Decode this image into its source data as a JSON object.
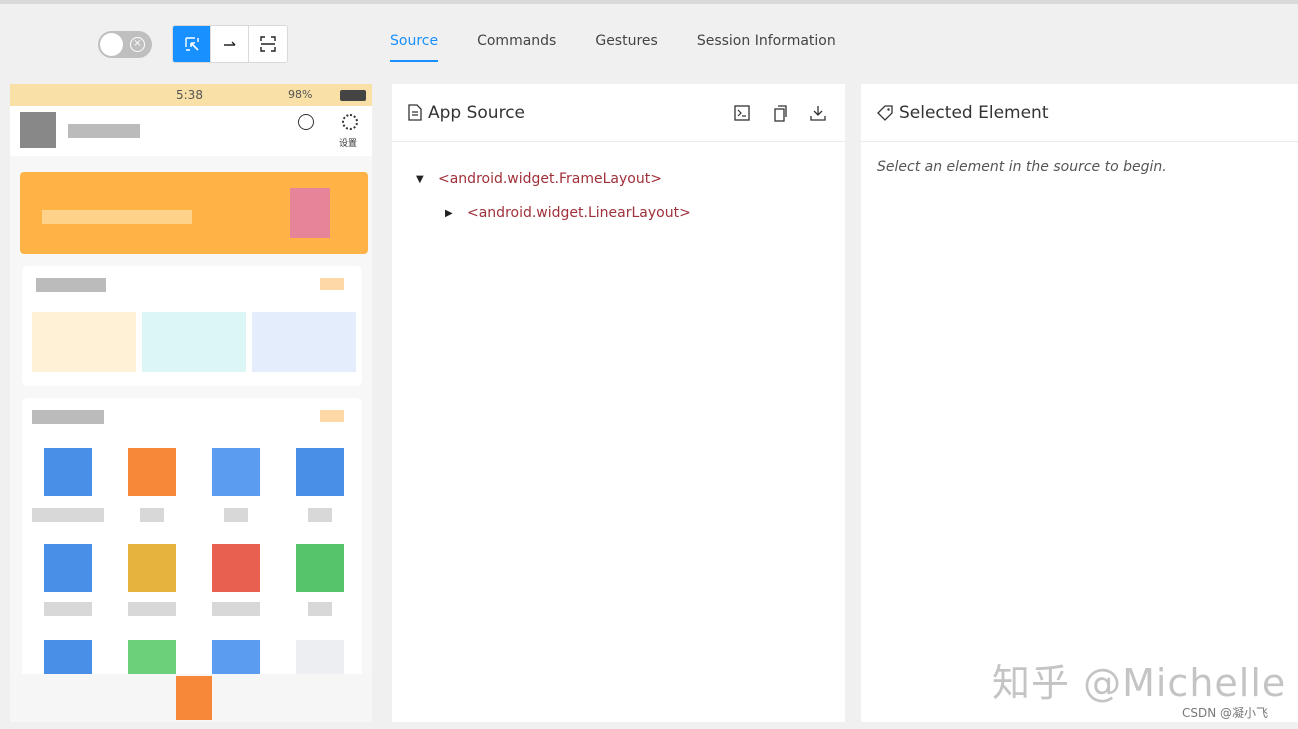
{
  "toolbar": {
    "tabs": [
      {
        "label": "Source",
        "active": true
      },
      {
        "label": "Commands",
        "active": false
      },
      {
        "label": "Gestures",
        "active": false
      },
      {
        "label": "Session Information",
        "active": false
      }
    ],
    "tools": [
      "select-elements-icon",
      "swipe-arrow-icon",
      "tap-by-coordinates-icon"
    ]
  },
  "device": {
    "status_time": "5:38",
    "status_right": "98%",
    "header_labels": [
      "设置"
    ]
  },
  "app_source": {
    "title": "App Source",
    "icons": [
      "terminal-icon",
      "copy-icon",
      "download-icon"
    ],
    "tree": [
      {
        "label": "<android.widget.FrameLayout>",
        "expanded": true
      },
      {
        "label": "<android.widget.LinearLayout>",
        "expanded": false
      }
    ]
  },
  "selected_element": {
    "title": "Selected Element",
    "hint": "Select an element in the source to begin."
  },
  "watermark": {
    "main": "知乎 @Michelle",
    "sub": "CSDN @凝小飞"
  },
  "colors": {
    "accent": "#1890ff",
    "tag": "#a0303a"
  }
}
